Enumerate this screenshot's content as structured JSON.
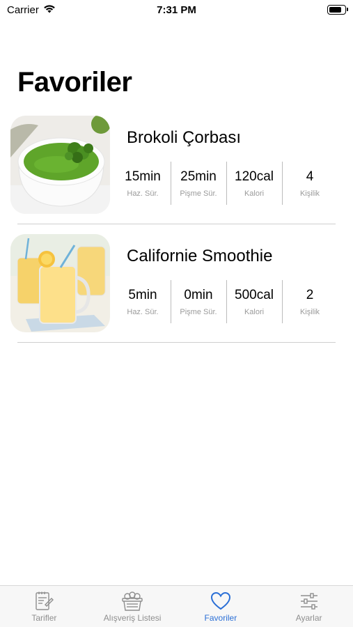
{
  "status_bar": {
    "carrier": "Carrier",
    "time": "7:31 PM",
    "battery_level": 0.85
  },
  "page": {
    "title": "Favoriler"
  },
  "recipes": [
    {
      "name": "Brokoli Çorbası",
      "image": "broccoli-soup-photo",
      "stats": [
        {
          "value": "15min",
          "label": "Haz. Sür."
        },
        {
          "value": "25min",
          "label": "Pişme Sür."
        },
        {
          "value": "120cal",
          "label": "Kalori"
        },
        {
          "value": "4",
          "label": "Kişilik"
        }
      ]
    },
    {
      "name": "Californie Smoothie",
      "image": "smoothie-photo",
      "stats": [
        {
          "value": "5min",
          "label": "Haz. Sür."
        },
        {
          "value": "0min",
          "label": "Pişme Sür."
        },
        {
          "value": "500cal",
          "label": "Kalori"
        },
        {
          "value": "2",
          "label": "Kişilik"
        }
      ]
    }
  ],
  "tab_bar": {
    "tabs": [
      {
        "label": "Tarifler",
        "icon": "recipe-book-icon"
      },
      {
        "label": "Alışveriş Listesi",
        "icon": "shopping-basket-icon"
      },
      {
        "label": "Favoriler",
        "icon": "heart-icon"
      },
      {
        "label": "Ayarlar",
        "icon": "sliders-icon"
      }
    ],
    "active_index": 2,
    "active_color": "#2b6fd6",
    "inactive_color": "#8e8e8e"
  }
}
